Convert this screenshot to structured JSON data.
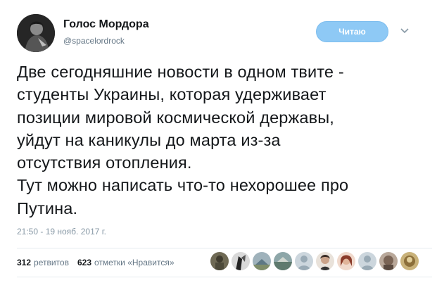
{
  "tweet": {
    "author_name": "Голос Мордора",
    "author_handle": "@spacelordrock",
    "follow_label": "Читаю",
    "text_lines": [
      "Две сегодняшние новости в одном твите -",
      "студенты Украины, которая удерживает",
      "позиции мировой космической державы,",
      "уйдут на каникулы до марта из-за",
      "отсутствия отопления.",
      "Тут можно написать что-то нехорошее про",
      "Путина."
    ],
    "timestamp": "21:50 - 19 нояб. 2017 г."
  },
  "stats": {
    "retweets_count": "312",
    "retweets_label": "ретвитов",
    "likes_count": "623",
    "likes_label": "отметки «Нравится»"
  },
  "likers": {
    "count": 9
  },
  "colors": {
    "follow_button": "#8ec9f5",
    "text": "#14171a",
    "muted": "#657786",
    "divider": "#e6ecf0"
  },
  "icons": {
    "chevron": "chevron-down-icon"
  }
}
